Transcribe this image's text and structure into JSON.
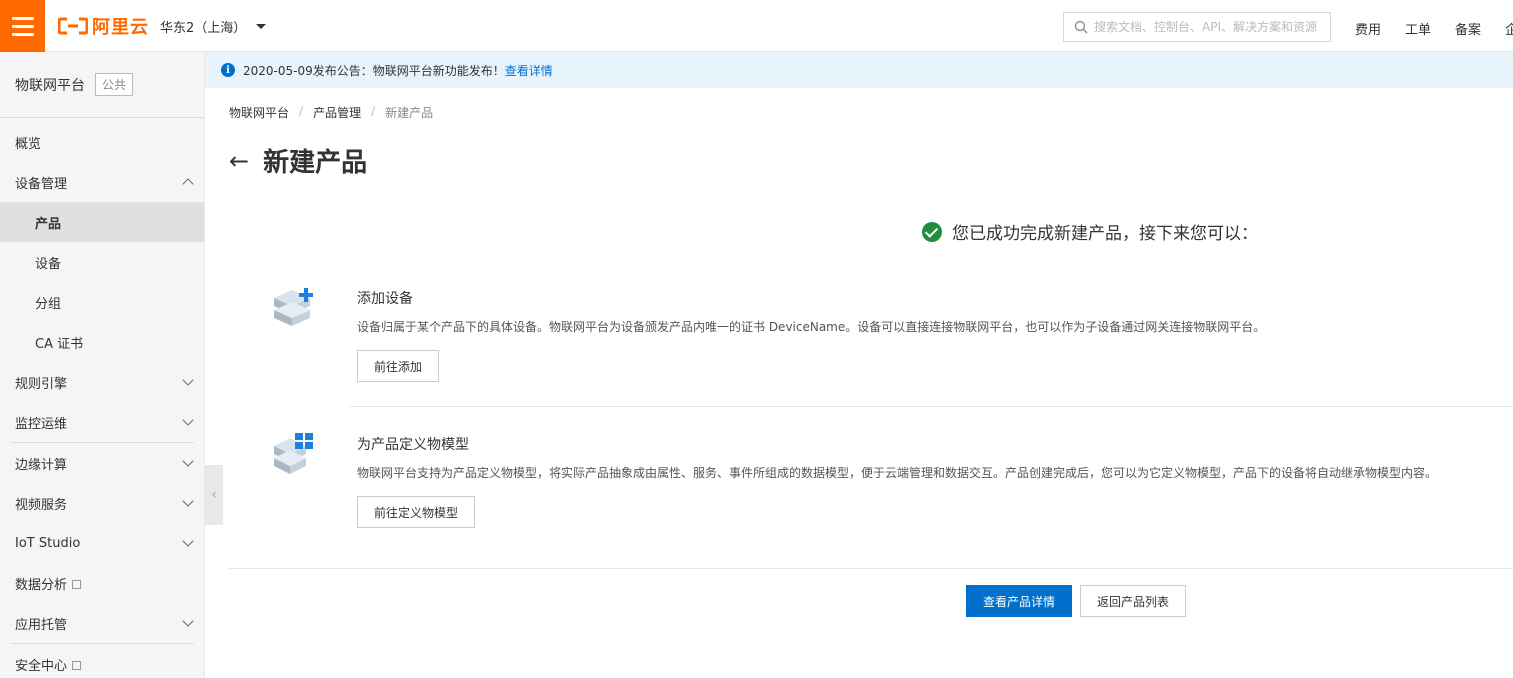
{
  "topbar": {
    "logo_text": "阿里云",
    "region": "华东2（上海）",
    "search_placeholder": "搜索文档、控制台、API、解决方案和资源",
    "nav": [
      "费用",
      "工单",
      "备案",
      "企"
    ]
  },
  "sidebar": {
    "title": "物联网平台",
    "badge": "公共",
    "items": [
      {
        "label": "概览"
      },
      {
        "label": "设备管理"
      },
      {
        "label": "产品"
      },
      {
        "label": "设备"
      },
      {
        "label": "分组"
      },
      {
        "label": "CA 证书"
      },
      {
        "label": "规则引擎"
      },
      {
        "label": "监控运维"
      },
      {
        "label": "边缘计算"
      },
      {
        "label": "视频服务"
      },
      {
        "label": "IoT Studio"
      },
      {
        "label": "数据分析"
      },
      {
        "label": "应用托管"
      },
      {
        "label": "安全中心"
      }
    ]
  },
  "notice": {
    "text": "2020-05-09发布公告：物联网平台新功能发布！",
    "link": "查看详情"
  },
  "breadcrumb": [
    "物联网平台",
    "产品管理",
    "新建产品"
  ],
  "page_title": "新建产品",
  "success_message": "您已成功完成新建产品，接下来您可以：",
  "steps": [
    {
      "title": "添加设备",
      "desc": "设备归属于某个产品下的具体设备。物联网平台为设备颁发产品内唯一的证书 DeviceName。设备可以直接连接物联网平台，也可以作为子设备通过网关连接物联网平台。",
      "button": "前往添加"
    },
    {
      "title": "为产品定义物模型",
      "desc": "物联网平台支持为产品定义物模型，将实际产品抽象成由属性、服务、事件所组成的数据模型，便于云端管理和数据交互。产品创建完成后，您可以为它定义物模型，产品下的设备将自动继承物模型内容。",
      "button": "前往定义物模型"
    }
  ],
  "actions": {
    "primary": "查看产品详情",
    "secondary": "返回产品列表"
  },
  "colors": {
    "brand": "#ff6a00",
    "primary": "#0070cc",
    "success": "#1e8e3e"
  }
}
